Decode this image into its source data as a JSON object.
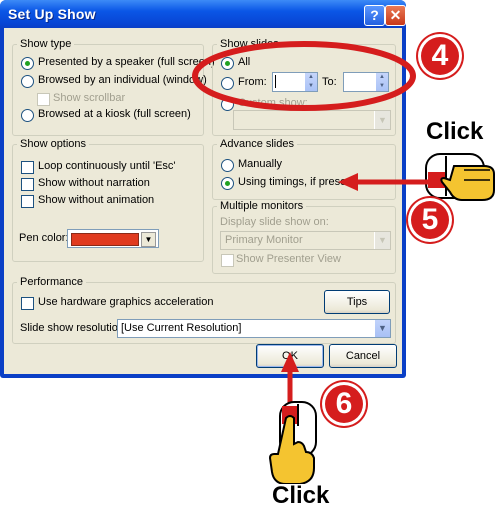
{
  "dialog": {
    "title": "Set Up Show",
    "help_glyph": "?",
    "close_glyph": "✕",
    "show_type": {
      "legend": "Show type",
      "options": [
        "Presented by a speaker (full screen)",
        "Browsed by an individual (window)",
        "Browsed at a kiosk (full screen)"
      ],
      "selected_index": 0,
      "show_scrollbar": "Show scrollbar"
    },
    "show_slides": {
      "legend": "Show slides",
      "all": "All",
      "from": "From:",
      "to": "To:",
      "from_value": "",
      "to_value": "",
      "custom_show": "Custom show:"
    },
    "show_options": {
      "legend": "Show options",
      "loop": "Loop continuously until 'Esc'",
      "no_narration": "Show without narration",
      "no_animation": "Show without animation",
      "pen_color": "Pen color:",
      "pen_color_value": "#e03a1f"
    },
    "advance_slides": {
      "legend": "Advance slides",
      "manually": "Manually",
      "timings": "Using timings, if present",
      "selected": "timings"
    },
    "multiple_monitors": {
      "legend": "Multiple monitors",
      "display_on": "Display slide show on:",
      "monitor": "Primary Monitor",
      "presenter_view": "Show Presenter View"
    },
    "performance": {
      "legend": "Performance",
      "hw_accel": "Use hardware graphics acceleration",
      "tips": "Tips",
      "resolution_label": "Slide show resolution:",
      "resolution_value": "[Use Current Resolution]"
    },
    "ok": "OK",
    "cancel": "Cancel"
  },
  "callouts": {
    "step4": "4",
    "step5": "5",
    "step6": "6",
    "click_top": "Click",
    "click_bottom": "Click",
    "accent": "#d51d1d"
  }
}
